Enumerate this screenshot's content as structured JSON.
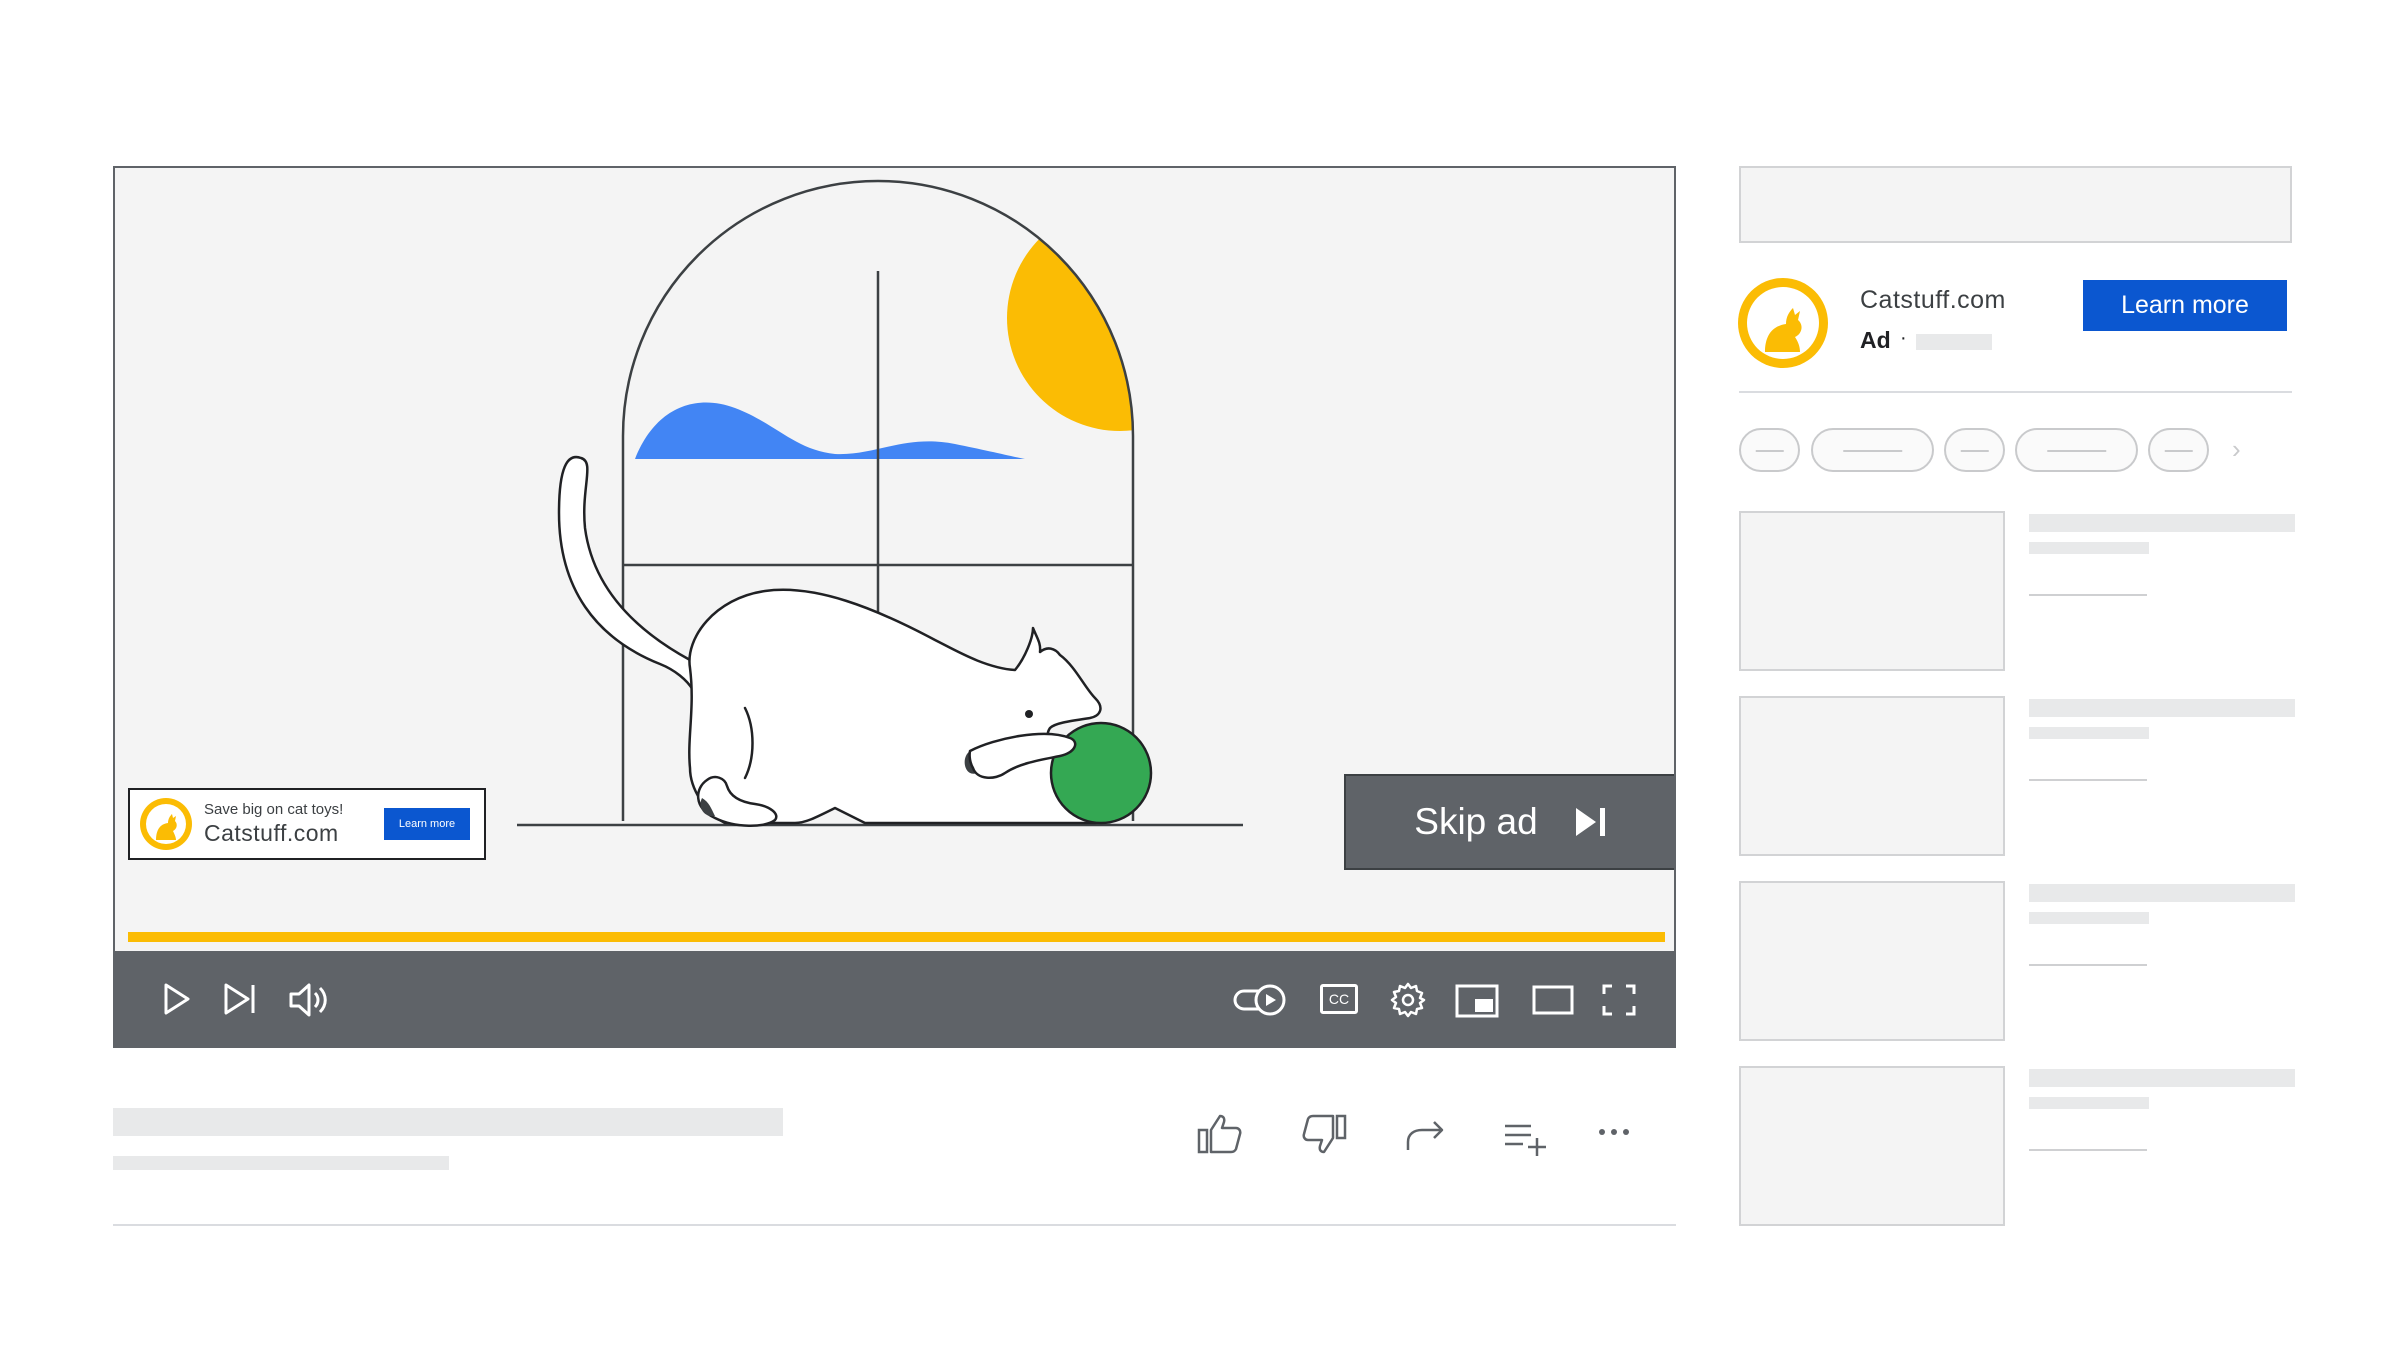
{
  "overlay_ad": {
    "tagline": "Save big on cat toys!",
    "domain": "Catstuff.com",
    "button_label": "Learn more"
  },
  "skip_ad": {
    "label": "Skip ad"
  },
  "progress": {
    "played_fraction": 1.0
  },
  "controls": {
    "left": [
      "play-icon",
      "next-icon",
      "volume-icon"
    ],
    "right": [
      "autoplay-toggle-icon",
      "captions-icon",
      "settings-icon",
      "miniplayer-icon",
      "theater-icon",
      "fullscreen-icon"
    ],
    "cc_label": "CC"
  },
  "actions": [
    "like-icon",
    "dislike-icon",
    "share-icon",
    "save-to-playlist-icon",
    "more-icon"
  ],
  "sidebar_ad": {
    "domain": "Catstuff.com",
    "ad_label": "Ad",
    "separator": "·",
    "button_label": "Learn more"
  },
  "chips_next": "›",
  "colors": {
    "accent_blue": "#0b57d0",
    "brand_yellow": "#fbbc04",
    "controls_gray": "#5f6368",
    "ball_green": "#34a853",
    "cloud_blue": "#4285f4"
  }
}
